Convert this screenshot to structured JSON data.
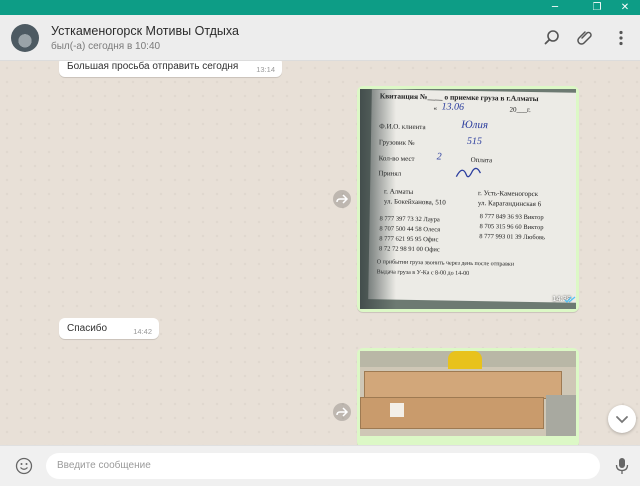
{
  "window": {
    "accent": "#0d9d86",
    "minimize_glyph": "─",
    "restore_glyph": "❐",
    "close_glyph": "✕"
  },
  "chat": {
    "title": "Усткаменогорск Мотивы Отдыха",
    "status": "был(-а) сегодня в 10:40"
  },
  "header_icons": [
    "search-icon",
    "paperclip-icon",
    "more-icon"
  ],
  "messages": {
    "m1": {
      "text": "Большая просьба отправить сегодня",
      "time": "13:14"
    },
    "m2": {
      "time": "14:38"
    },
    "m3": {
      "text": "Спасибо",
      "time": "14:42"
    }
  },
  "receipt": {
    "title": "Квитанция №____ о приемке груза в г.Алматы",
    "date_label": "«",
    "date_hand": "13.06",
    "year_suffix": "20___г.",
    "fio_label": "Ф.И.О. клиента",
    "fio_hand": "Юлия",
    "truck_label": "Грузовик №",
    "truck_hand": "515",
    "seats_label": "Кол-во мест",
    "seats_hand": "2",
    "payment_label": "Оплата",
    "accepted_label": "Принял",
    "city_a": "г. Алматы",
    "addr_a": "ул. Бокейханова, 510",
    "city_b": "г. Усть-Каменогорск",
    "addr_b": "ул. Карагандинская 6",
    "phones_a": [
      "8 777 397 73 32  Лаура",
      "8 707 500 44 58  Олеся",
      "8 777 621 95 95  Офис",
      "8 72 72 98 91 00  Офис"
    ],
    "phones_b": [
      "8 777 849 36 93  Виктор",
      "8 705 315 96 60  Виктор",
      "8 777 993 01 39  Любовь"
    ],
    "note1": "О прибытии груза звонить через день после отправки",
    "note2": "Выдача груза в У-Ка с 8-00 до 14-00"
  },
  "composer": {
    "placeholder": "Введите сообщение"
  },
  "colors": {
    "incoming": "#ffffff",
    "outgoing": "#dcf8c6",
    "background": "#e5ddd5",
    "read_ticks": "#4fc3f7"
  }
}
